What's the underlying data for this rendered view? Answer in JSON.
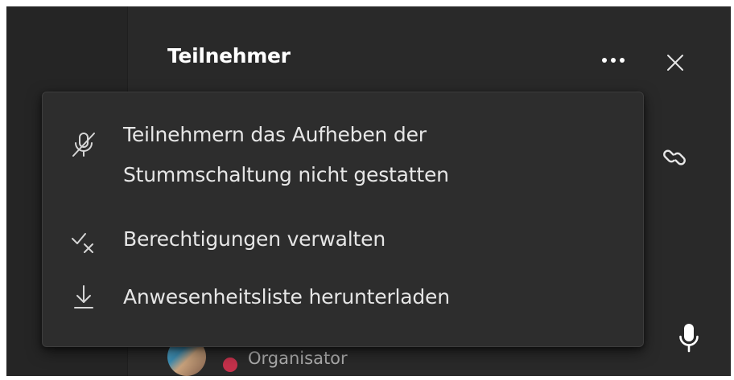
{
  "panel": {
    "title": "Teilnehmer",
    "more_icon": "more-horizontal-icon",
    "close_icon": "close-icon",
    "link_icon": "link-icon",
    "mic_icon": "microphone-icon"
  },
  "menu": {
    "items": [
      {
        "label": "Teilnehmern das Aufheben der\nStummschaltung nicht gestatten",
        "icon": "mic-off-icon"
      },
      {
        "label": "Berechtigungen verwalten",
        "icon": "check-cross-icon"
      },
      {
        "label": "Anwesenheitsliste herunterladen",
        "icon": "download-icon"
      }
    ]
  },
  "participant": {
    "role": "Organisator",
    "status_color": "#c4314b"
  },
  "colors": {
    "background": "#292929",
    "menu_background": "#2d2d2d",
    "text": "#e6e6e6",
    "muted_text": "#adadad"
  }
}
